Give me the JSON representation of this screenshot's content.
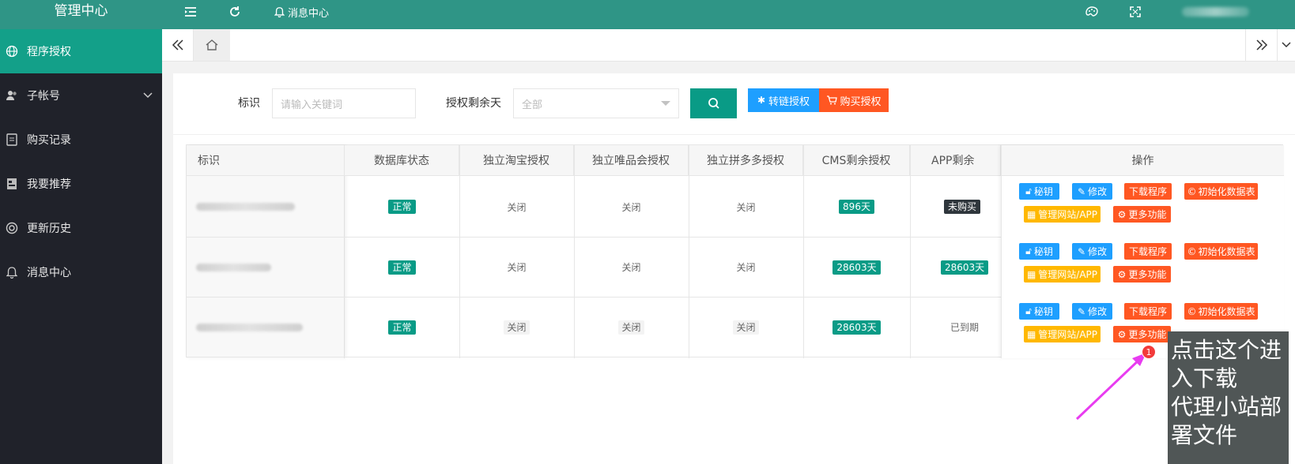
{
  "app": {
    "title": "管理中心"
  },
  "sidebar": {
    "items": [
      {
        "label": "程序授权",
        "icon": "globe-icon",
        "active": true
      },
      {
        "label": "子帐号",
        "icon": "users-icon",
        "active": false
      },
      {
        "label": "购买记录",
        "icon": "document-icon",
        "active": false
      },
      {
        "label": "我要推荐",
        "icon": "recommend-icon",
        "active": false
      },
      {
        "label": "更新历史",
        "icon": "history-icon",
        "active": false
      },
      {
        "label": "消息中心",
        "icon": "bell-icon",
        "active": false
      }
    ]
  },
  "header": {
    "message_center": "消息中心"
  },
  "filter": {
    "id_label": "标识",
    "id_placeholder": "请输入关键词",
    "days_label": "授权剩余天",
    "days_select": "全部",
    "transfer_button": "转链授权",
    "buy_button": "购买授权"
  },
  "table": {
    "headers": [
      "标识",
      "数据库状态",
      "独立淘宝授权",
      "独立唯品会授权",
      "独立拼多多授权",
      "CMS剩余授权",
      "APP剩余",
      "操作"
    ],
    "rows": [
      {
        "db_status": "正常",
        "taobao": "关闭",
        "vip": "关闭",
        "pdd": "关闭",
        "cms": "896天",
        "app": "未购买"
      },
      {
        "db_status": "正常",
        "taobao": "关闭",
        "vip": "关闭",
        "pdd": "关闭",
        "cms": "28603天",
        "app": "28603天"
      },
      {
        "db_status": "正常",
        "taobao": "关闭",
        "vip": "关闭",
        "pdd": "关闭",
        "cms": "28603天",
        "app": "已到期"
      }
    ],
    "ops": {
      "key": "秘钥",
      "edit": "修改",
      "download": "下载程序",
      "init_db": "初始化数据表",
      "manage_site": "管理网站/APP",
      "more": "更多功能"
    }
  },
  "annotation": {
    "badge": "1",
    "line1": "点击这个进",
    "line2": "入下载",
    "line3": "代理小站部",
    "line4": "署文件"
  },
  "colors": {
    "primary": "#2f9586",
    "active": "#13a089",
    "blue": "#1e9fff",
    "red": "#ff5722",
    "yellow": "#ffb800",
    "sidebar_bg": "#20222a"
  }
}
